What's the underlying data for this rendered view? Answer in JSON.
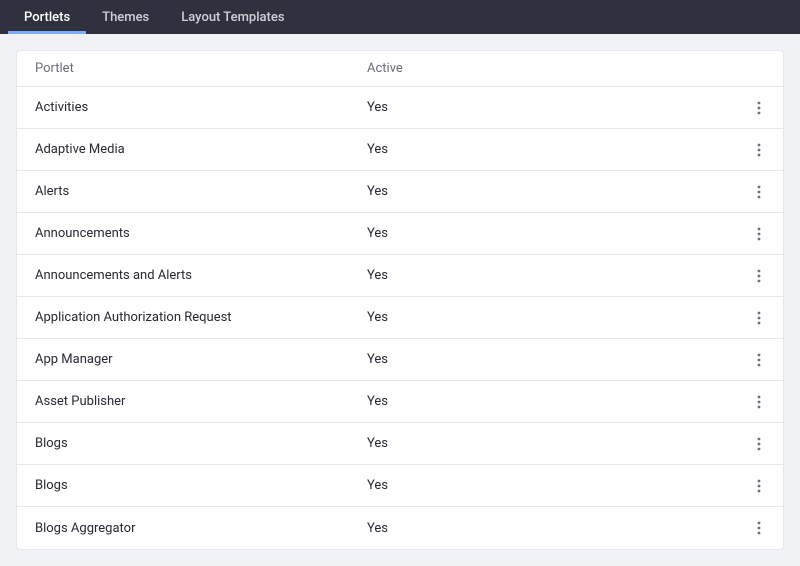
{
  "nav": {
    "tabs": [
      {
        "label": "Portlets",
        "active": true
      },
      {
        "label": "Themes",
        "active": false
      },
      {
        "label": "Layout Templates",
        "active": false
      }
    ]
  },
  "table": {
    "headers": {
      "name": "Portlet",
      "active": "Active"
    },
    "rows": [
      {
        "name": "Activities",
        "active": "Yes"
      },
      {
        "name": "Adaptive Media",
        "active": "Yes"
      },
      {
        "name": "Alerts",
        "active": "Yes"
      },
      {
        "name": "Announcements",
        "active": "Yes"
      },
      {
        "name": "Announcements and Alerts",
        "active": "Yes"
      },
      {
        "name": "Application Authorization Request",
        "active": "Yes"
      },
      {
        "name": "App Manager",
        "active": "Yes"
      },
      {
        "name": "Asset Publisher",
        "active": "Yes"
      },
      {
        "name": "Blogs",
        "active": "Yes"
      },
      {
        "name": "Blogs",
        "active": "Yes"
      },
      {
        "name": "Blogs Aggregator",
        "active": "Yes"
      }
    ]
  }
}
